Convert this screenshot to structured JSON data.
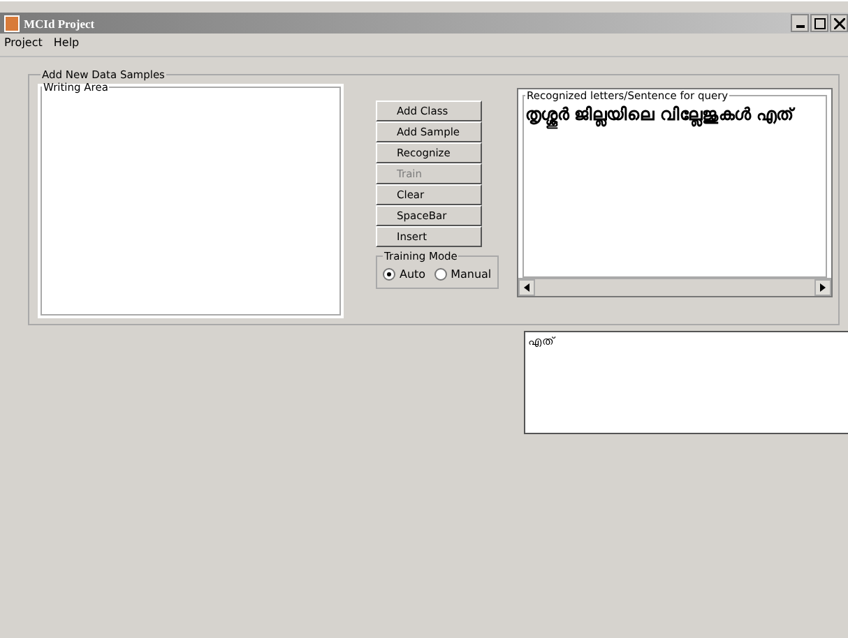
{
  "window": {
    "title": "MCId Project"
  },
  "menu": [
    "Project",
    "Help"
  ],
  "panel": {
    "title": "Add New Data Samples"
  },
  "writing_area": {
    "title": "Writing Area"
  },
  "buttons": [
    {
      "label": "Add Class",
      "disabled": false
    },
    {
      "label": "Add Sample",
      "disabled": false
    },
    {
      "label": "Recognize",
      "disabled": false
    },
    {
      "label": "Train",
      "disabled": true
    },
    {
      "label": "Clear",
      "disabled": false
    },
    {
      "label": "SpaceBar",
      "disabled": false
    },
    {
      "label": "Insert",
      "disabled": false
    }
  ],
  "training_mode": {
    "title": "Training Mode",
    "options": [
      {
        "label": "Auto",
        "selected": true
      },
      {
        "label": "Manual",
        "selected": false
      }
    ]
  },
  "recognized": {
    "title": "Recognized letters/Sentence for query",
    "text": "തൃശ്ശൂർ ജില്ലയിലെ വില്ലേജുകൾ എത്"
  },
  "query": {
    "value": "എത്"
  }
}
